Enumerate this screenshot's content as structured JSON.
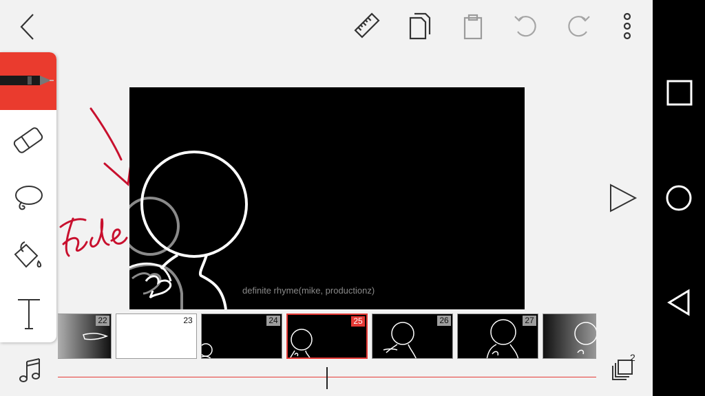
{
  "toolbar": {
    "icons": [
      "back-icon",
      "ruler-icon",
      "copy-icon",
      "paste-icon",
      "undo-icon",
      "redo-icon",
      "more-icon"
    ]
  },
  "tools": [
    "pen-icon",
    "eraser-icon",
    "lasso-icon",
    "fill-bucket-icon",
    "text-icon"
  ],
  "canvas": {
    "credit_text": "definite rhyme(mike, productionz)",
    "annotation_text": "fade"
  },
  "frames": [
    {
      "number": "22"
    },
    {
      "number": "23"
    },
    {
      "number": "24"
    },
    {
      "number": "25"
    },
    {
      "number": "26"
    },
    {
      "number": "27"
    }
  ],
  "current_frame": "25",
  "layers": {
    "count": "2"
  },
  "colors": {
    "accent": "#ea3b2e",
    "background": "#f2f2f2",
    "canvas": "#000000",
    "annotation": "#c8102e"
  }
}
